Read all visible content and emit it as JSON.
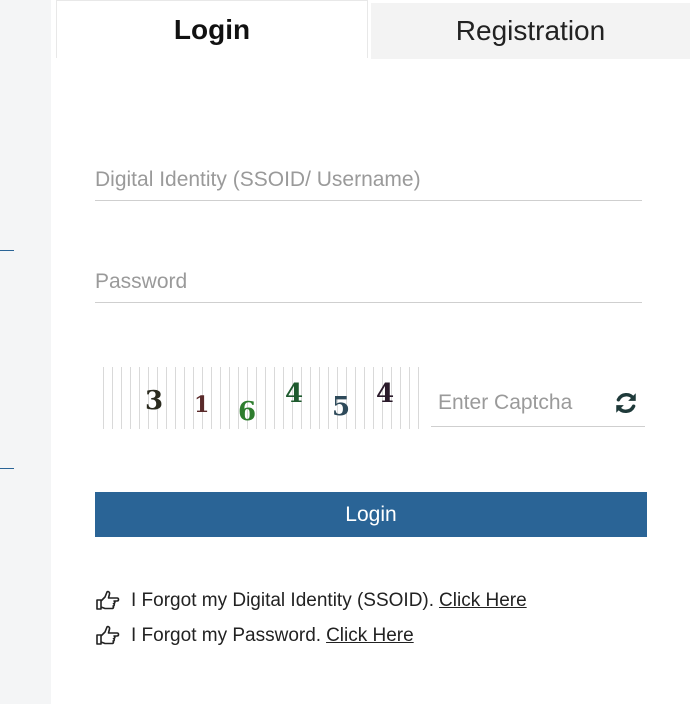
{
  "tabs": {
    "login": "Login",
    "registration": "Registration"
  },
  "form": {
    "username_placeholder": "Digital Identity (SSOID/ Username)",
    "password_placeholder": "Password",
    "captcha_placeholder": "Enter Captcha",
    "captcha_digits": [
      "3",
      "1",
      "6",
      "4",
      "5",
      "4"
    ],
    "login_button": "Login"
  },
  "help": {
    "forgot_ssoid_text": "I Forgot my Digital Identity (SSOID).",
    "forgot_ssoid_link": "Click Here",
    "forgot_password_text": "I Forgot my Password.",
    "forgot_password_link": "Click Here"
  },
  "icons": {
    "refresh": "refresh-icon",
    "hand": "hand-pointing-right-icon"
  },
  "colors": {
    "primary": "#2a6496",
    "tab_inactive": "#f3f3f3"
  }
}
